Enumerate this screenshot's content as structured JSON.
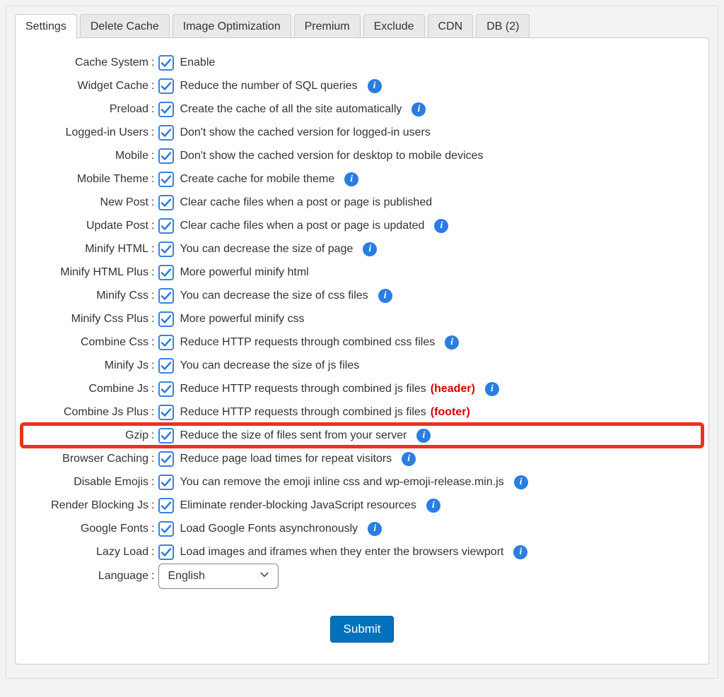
{
  "tabs": [
    {
      "label": "Settings",
      "active": true
    },
    {
      "label": "Delete Cache"
    },
    {
      "label": "Image Optimization"
    },
    {
      "label": "Premium"
    },
    {
      "label": "Exclude"
    },
    {
      "label": "CDN"
    },
    {
      "label": "DB (2)"
    }
  ],
  "rows": [
    {
      "label": "Cache System",
      "desc": "Enable"
    },
    {
      "label": "Widget Cache",
      "desc": "Reduce the number of SQL queries",
      "info": true
    },
    {
      "label": "Preload",
      "desc": "Create the cache of all the site automatically",
      "info": true
    },
    {
      "label": "Logged-in Users",
      "desc": "Don't show the cached version for logged-in users"
    },
    {
      "label": "Mobile",
      "desc": "Don't show the cached version for desktop to mobile devices"
    },
    {
      "label": "Mobile Theme",
      "desc": "Create cache for mobile theme",
      "info": true
    },
    {
      "label": "New Post",
      "desc": "Clear cache files when a post or page is published"
    },
    {
      "label": "Update Post",
      "desc": "Clear cache files when a post or page is updated",
      "info": true
    },
    {
      "label": "Minify HTML",
      "desc": "You can decrease the size of page",
      "info": true
    },
    {
      "label": "Minify HTML Plus",
      "desc": "More powerful minify html"
    },
    {
      "label": "Minify Css",
      "desc": "You can decrease the size of css files",
      "info": true
    },
    {
      "label": "Minify Css Plus",
      "desc": "More powerful minify css"
    },
    {
      "label": "Combine Css",
      "desc": "Reduce HTTP requests through combined css files",
      "info": true
    },
    {
      "label": "Minify Js",
      "desc": "You can decrease the size of js files"
    },
    {
      "label": "Combine Js",
      "desc": "Reduce HTTP requests through combined js files",
      "badge": "(header)",
      "info": true
    },
    {
      "label": "Combine Js Plus",
      "desc": "Reduce HTTP requests through combined js files",
      "badge": "(footer)"
    },
    {
      "label": "Gzip",
      "desc": "Reduce the size of files sent from your server",
      "info": true,
      "highlight": true
    },
    {
      "label": "Browser Caching",
      "desc": "Reduce page load times for repeat visitors",
      "info": true
    },
    {
      "label": "Disable Emojis",
      "desc": "You can remove the emoji inline css and wp-emoji-release.min.js",
      "info": true
    },
    {
      "label": "Render Blocking Js",
      "desc": "Eliminate render-blocking JavaScript resources",
      "info": true
    },
    {
      "label": "Google Fonts",
      "desc": "Load Google Fonts asynchronously",
      "info": true
    },
    {
      "label": "Lazy Load",
      "desc": "Load images and iframes when they enter the browsers viewport",
      "info": true
    }
  ],
  "language_row": {
    "label": "Language",
    "value": "English"
  },
  "submit_label": "Submit"
}
